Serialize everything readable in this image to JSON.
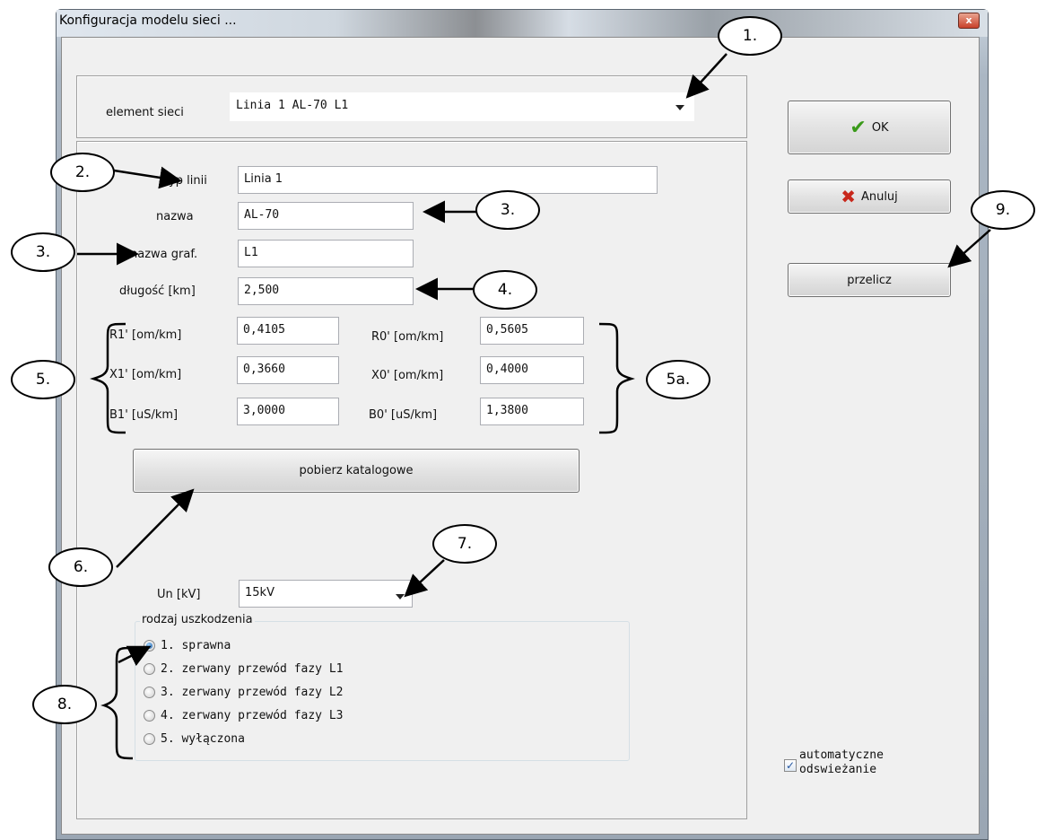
{
  "window": {
    "title": "Konfiguracja modelu sieci ...",
    "close_glyph": "x"
  },
  "element_sieci": {
    "label": "element sieci",
    "value": "Linia 1  AL-70   L1"
  },
  "fields": {
    "typ_linii": {
      "label": "typ linii",
      "value": "Linia 1"
    },
    "nazwa": {
      "label": "nazwa",
      "value": "AL-70"
    },
    "nazwa_graf": {
      "label": "nazwa graf.",
      "value": "L1"
    },
    "dlugosc": {
      "label": "długość [km]",
      "value": "2,500"
    }
  },
  "params_left": [
    {
      "label": "R1' [om/km]",
      "value": "0,4105"
    },
    {
      "label": "X1' [om/km]",
      "value": "0,3660"
    },
    {
      "label": "B1' [uS/km]",
      "value": "3,0000"
    }
  ],
  "params_right": [
    {
      "label": "R0' [om/km]",
      "value": "0,5605"
    },
    {
      "label": "X0' [om/km]",
      "value": "0,4000"
    },
    {
      "label": "B0' [uS/km]",
      "value": "1,3800"
    }
  ],
  "buttons": {
    "pobierz": "pobierz katalogowe",
    "ok": "OK",
    "anuluj": "Anuluj",
    "przelicz": "przelicz"
  },
  "un": {
    "label": "Un [kV]",
    "value": "15kV"
  },
  "rodzaj": {
    "title": "rodzaj uszkodzenia",
    "options": [
      "1. sprawna",
      "2. zerwany przewód fazy L1",
      "3. zerwany przewód fazy L2",
      "4. zerwany przewód fazy L3",
      "5. wyłączona"
    ],
    "selected_index": 0
  },
  "auto_refresh": {
    "label_line1": "automatyczne",
    "label_line2": "odswieżanie",
    "checked": true
  },
  "annotations": [
    "1.",
    "2.",
    "3.",
    "3.",
    "4.",
    "5.",
    "5a.",
    "6.",
    "7.",
    "8.",
    "9."
  ],
  "colors": {
    "ok_check": "#3a9a1a",
    "cancel_x": "#c8281c",
    "radio_selected": "#1c5fa8"
  }
}
